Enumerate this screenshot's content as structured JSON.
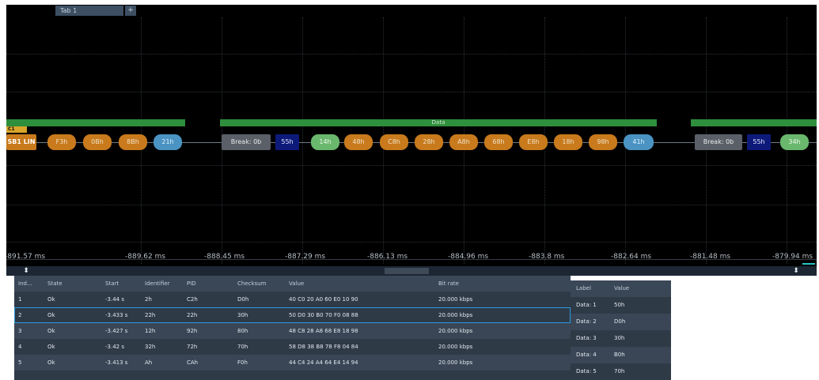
{
  "tab": {
    "label": "Tab 1",
    "add": "+"
  },
  "channel": {
    "badge": "C1",
    "name": "SB1 LIN"
  },
  "waveform": {
    "group1": [
      "F3h",
      "0Bh",
      "8Bh",
      "21h"
    ],
    "break1": "Break: 0b",
    "sync1": "55h",
    "group2": [
      "14h",
      "48h",
      "C8h",
      "28h",
      "A8h",
      "68h",
      "E8h",
      "18h",
      "98h",
      "41h"
    ],
    "data_label": "Data",
    "break2": "Break: 0b",
    "sync2": "55h",
    "group3": [
      "34h"
    ]
  },
  "axis": {
    "ticks": [
      "-891.57 ms",
      "-889.62 ms",
      "-888.45 ms",
      "-887.29 ms",
      "-886.13 ms",
      "-884.96 ms",
      "-883.8 ms",
      "-882.64 ms",
      "-881.48 ms",
      "-879.94 ms"
    ]
  },
  "divider": {
    "expand_icon": "⬍"
  },
  "frames_table": {
    "headers": [
      "Ind...",
      "State",
      "Start",
      "Identifier",
      "PID",
      "Checksum",
      "Value",
      "Bit rate"
    ],
    "rows": [
      [
        "1",
        "Ok",
        "-3.44 s",
        "2h",
        "C2h",
        "D0h",
        "40 C0 20 A0 60 E0 10 90",
        "20.000 kbps"
      ],
      [
        "2",
        "Ok",
        "-3.433 s",
        "22h",
        "22h",
        "30h",
        "50 D0 30 B0 70 F0 08 88",
        "20.000 kbps"
      ],
      [
        "3",
        "Ok",
        "-3.427 s",
        "12h",
        "92h",
        "80h",
        "48 C8 28 A8 68 E8 18 98",
        "20.000 kbps"
      ],
      [
        "4",
        "Ok",
        "-3.42 s",
        "32h",
        "72h",
        "70h",
        "58 D8 38 B8 78 F8 04 84",
        "20.000 kbps"
      ],
      [
        "5",
        "Ok",
        "-3.413 s",
        "Ah",
        "CAh",
        "F0h",
        "44 C4 24 A4 64 E4 14 94",
        "20.000 kbps"
      ]
    ]
  },
  "detail_table": {
    "headers": [
      "Label",
      "Value"
    ],
    "rows": [
      [
        "Data: 1",
        "50h"
      ],
      [
        "Data: 2",
        "D0h"
      ],
      [
        "Data: 3",
        "30h"
      ],
      [
        "Data: 4",
        "B0h"
      ],
      [
        "Data: 5",
        "70h"
      ]
    ]
  }
}
